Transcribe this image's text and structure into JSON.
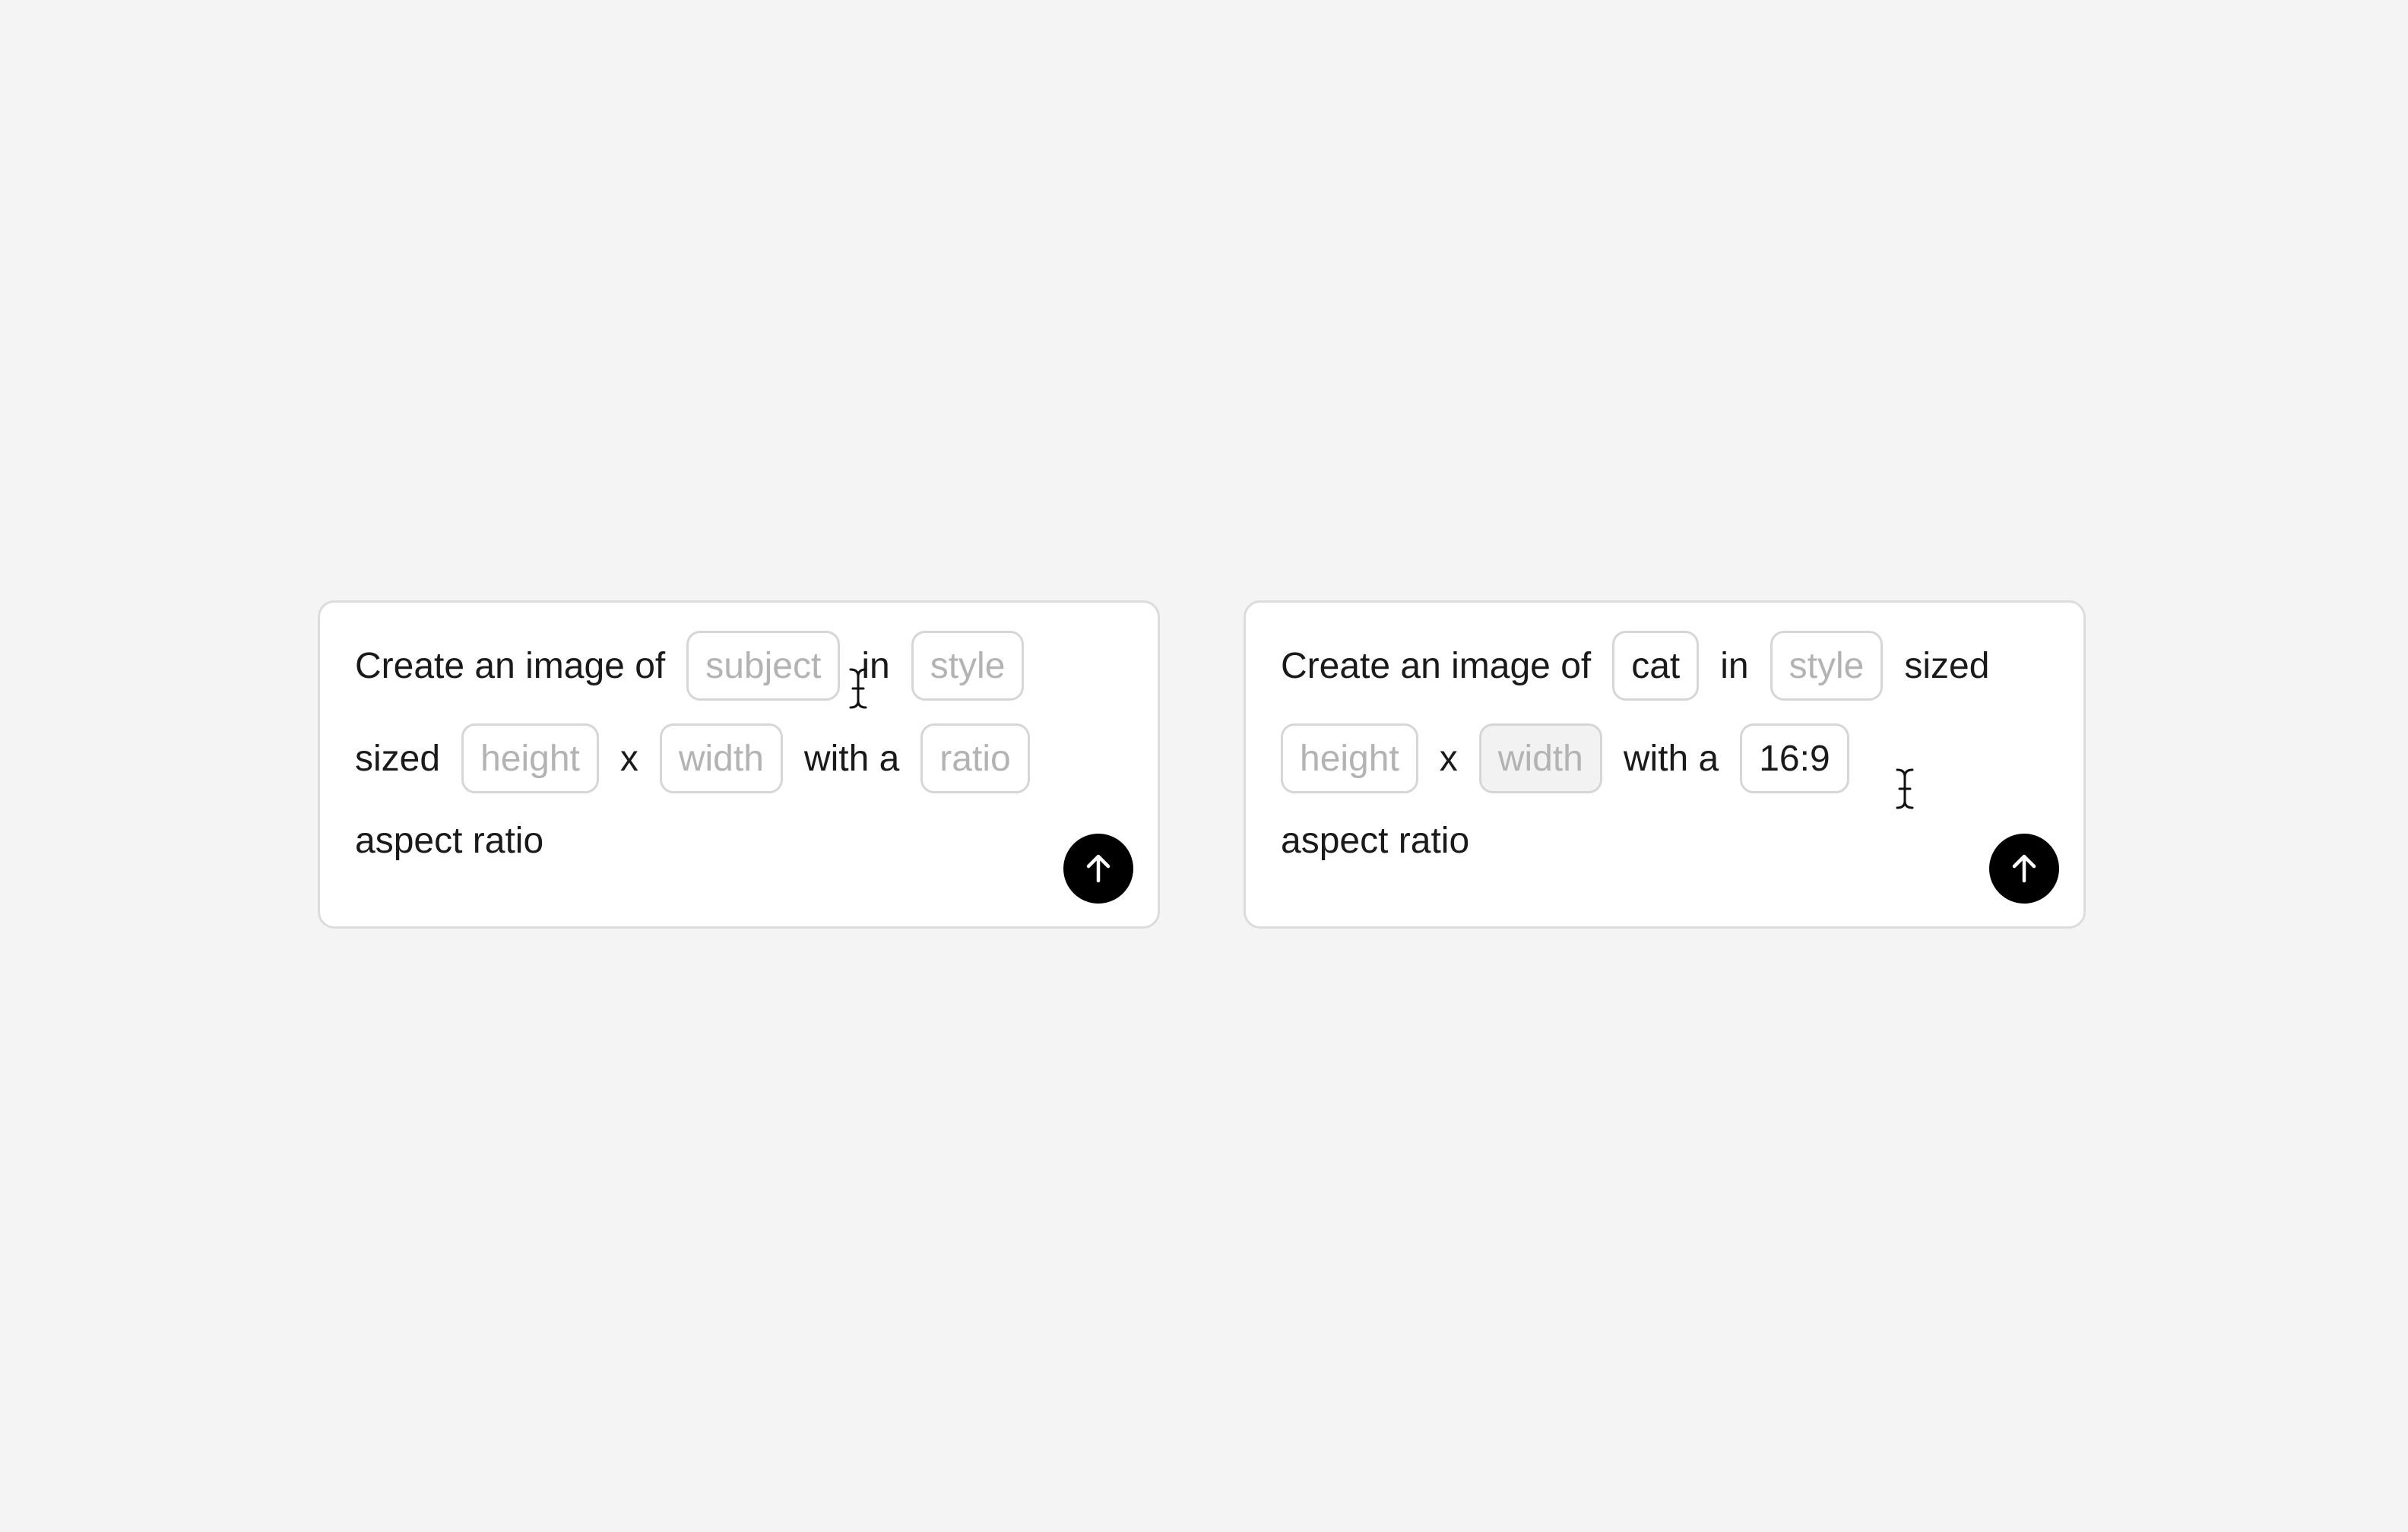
{
  "left_card": {
    "prefix": "Create an image of",
    "subject": "subject",
    "in_word": "in",
    "style": "style",
    "sized_word": "sized",
    "height": "height",
    "x_word": "x",
    "width": "width",
    "with_a": "with a",
    "ratio": "ratio",
    "suffix": "aspect ratio"
  },
  "right_card": {
    "prefix": "Create an image of",
    "subject": "cat",
    "in_word": "in",
    "style": "style",
    "sized_word": "sized",
    "height": "height",
    "x_word": "x",
    "width": "width",
    "with_a": "with a",
    "ratio": "16:9",
    "suffix": "aspect ratio"
  },
  "icons": {
    "send": "arrow-up-icon",
    "cursor": "text-cursor-icon"
  },
  "colors": {
    "background": "#f4f4f4",
    "card": "#ffffff",
    "send_button": "#000000",
    "placeholder_text": "#b3b3b3",
    "text": "#1a1a1a"
  }
}
